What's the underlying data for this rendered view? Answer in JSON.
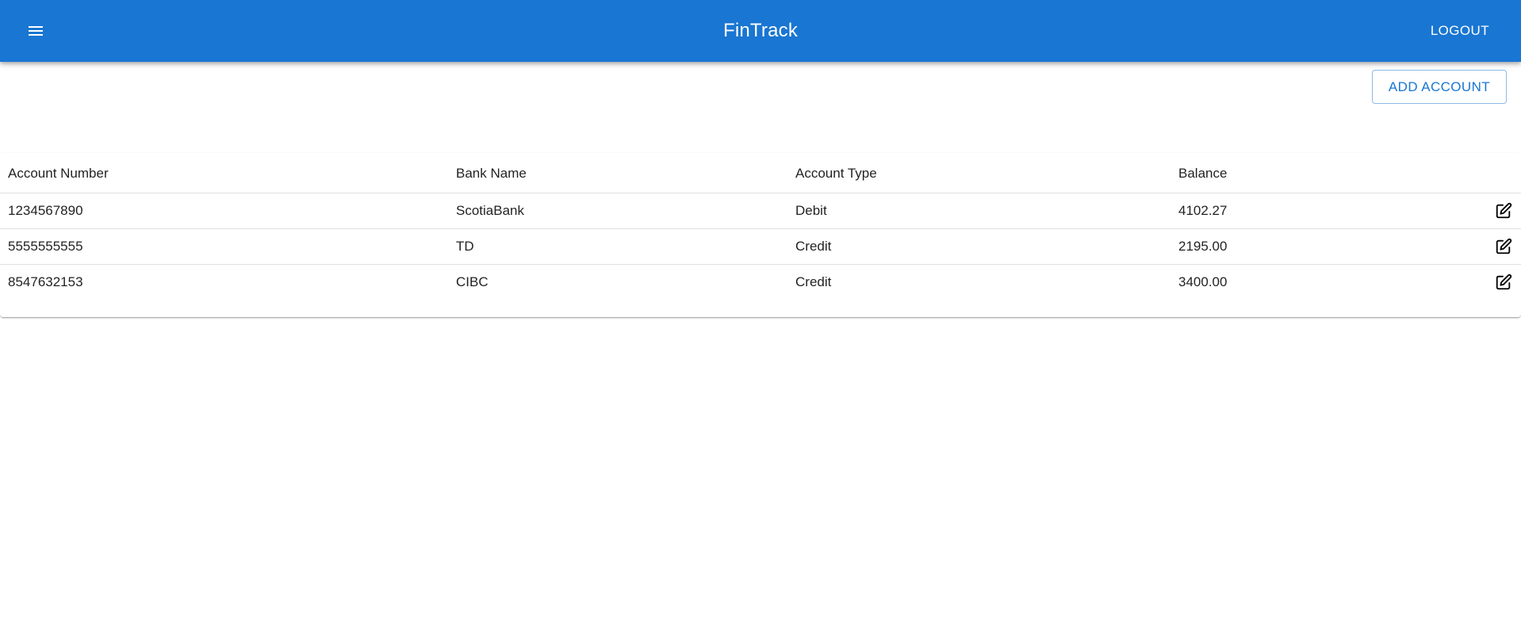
{
  "appbar": {
    "title": "FinTrack",
    "menu_icon": "menu-icon",
    "logout_label": "LOGOUT",
    "color": "#1976d2"
  },
  "toolbar": {
    "add_account_label": "ADD ACCOUNT"
  },
  "table": {
    "headers": {
      "account_number": "Account Number",
      "bank_name": "Bank Name",
      "account_type": "Account Type",
      "balance": "Balance"
    },
    "rows": [
      {
        "account_number": "1234567890",
        "bank_name": "ScotiaBank",
        "account_type": "Debit",
        "balance": "4102.27",
        "action_icon": "edit-icon"
      },
      {
        "account_number": "5555555555",
        "bank_name": "TD",
        "account_type": "Credit",
        "balance": "2195.00",
        "action_icon": "edit-icon"
      },
      {
        "account_number": "8547632153",
        "bank_name": "CIBC",
        "account_type": "Credit",
        "balance": "3400.00",
        "action_icon": "edit-icon"
      }
    ]
  }
}
